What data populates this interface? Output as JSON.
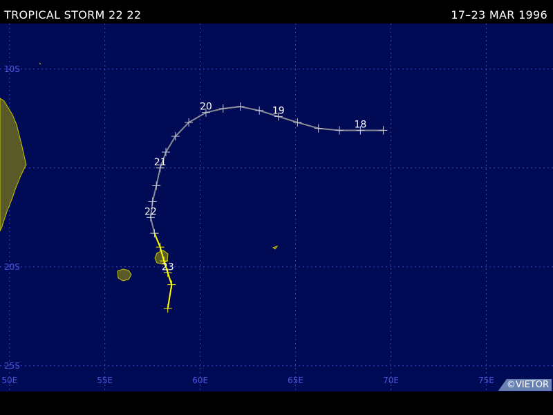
{
  "header": {
    "storm_title": "TROPICAL STORM 22 22",
    "date_range": "17–23 MAR 1996"
  },
  "credit": "©VIETOR",
  "colors": {
    "ocean": "#000a55",
    "grid": "#3c46d2",
    "land_fill": "#5a5a28",
    "land_outline": "#c8c800",
    "track_storm": "#888c96",
    "track_depression": "#ffff00",
    "label": "#ffffff",
    "axis_label": "#4a55e6"
  },
  "map": {
    "lon_range": [
      49.5,
      78.5
    ],
    "lat_range": [
      -26.3,
      -7.7
    ],
    "lon_ticks": [
      {
        "value": 50,
        "label": "50E"
      },
      {
        "value": 55,
        "label": "55E"
      },
      {
        "value": 60,
        "label": "60E"
      },
      {
        "value": 65,
        "label": "65E"
      },
      {
        "value": 70,
        "label": "70E"
      },
      {
        "value": 75,
        "label": "75E"
      }
    ],
    "lat_ticks": [
      {
        "value": -10,
        "label": "10S"
      },
      {
        "value": -15,
        "label": "15S"
      },
      {
        "value": -20,
        "label": "20S"
      },
      {
        "value": -25,
        "label": "25S"
      }
    ],
    "track": [
      {
        "lon": 69.6,
        "lat": -13.1,
        "type": "storm"
      },
      {
        "lon": 68.4,
        "lat": -13.1,
        "type": "storm",
        "label": "18"
      },
      {
        "lon": 67.3,
        "lat": -13.1,
        "type": "storm"
      },
      {
        "lon": 66.2,
        "lat": -13.0,
        "type": "storm"
      },
      {
        "lon": 65.1,
        "lat": -12.7,
        "type": "storm"
      },
      {
        "lon": 64.1,
        "lat": -12.4,
        "type": "storm",
        "label": "19"
      },
      {
        "lon": 63.1,
        "lat": -12.1,
        "type": "storm"
      },
      {
        "lon": 62.1,
        "lat": -11.9,
        "type": "storm"
      },
      {
        "lon": 61.2,
        "lat": -12.0,
        "type": "storm"
      },
      {
        "lon": 60.3,
        "lat": -12.2,
        "type": "storm",
        "label": "20"
      },
      {
        "lon": 59.4,
        "lat": -12.7,
        "type": "storm"
      },
      {
        "lon": 58.7,
        "lat": -13.4,
        "type": "storm"
      },
      {
        "lon": 58.2,
        "lat": -14.2,
        "type": "storm"
      },
      {
        "lon": 57.9,
        "lat": -15.0,
        "type": "storm",
        "label": "21"
      },
      {
        "lon": 57.7,
        "lat": -15.9,
        "type": "storm"
      },
      {
        "lon": 57.5,
        "lat": -16.7,
        "type": "storm"
      },
      {
        "lon": 57.4,
        "lat": -17.5,
        "type": "storm",
        "label": "22"
      },
      {
        "lon": 57.6,
        "lat": -18.3,
        "type": "storm"
      },
      {
        "lon": 57.9,
        "lat": -19.0,
        "type": "depression"
      },
      {
        "lon": 58.1,
        "lat": -19.7,
        "type": "depression"
      },
      {
        "lon": 58.3,
        "lat": -20.3,
        "type": "depression",
        "label": "23"
      },
      {
        "lon": 58.5,
        "lat": -20.9,
        "type": "depression"
      },
      {
        "lon": 58.3,
        "lat": -22.1,
        "type": "depression"
      }
    ]
  }
}
